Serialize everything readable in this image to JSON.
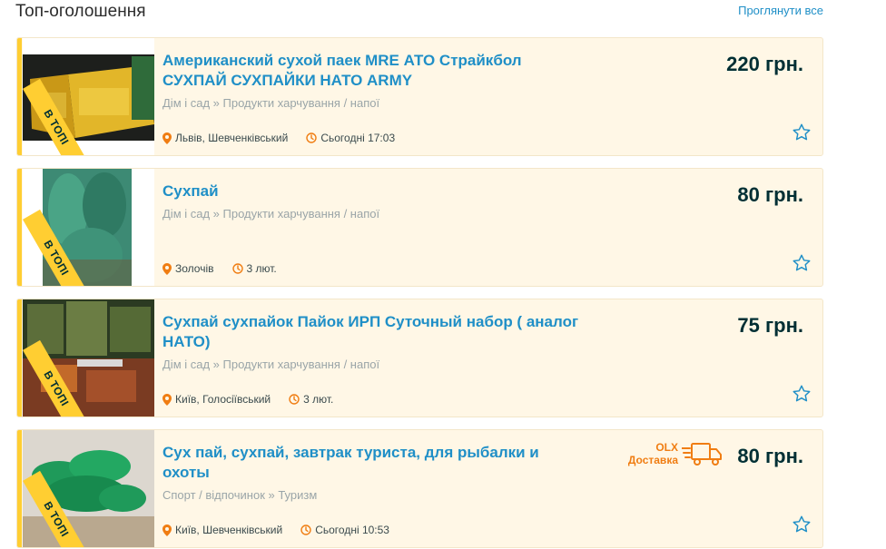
{
  "header": {
    "title": "Топ-оголошення",
    "view_all": "Проглянути все"
  },
  "listings": [
    {
      "title": "Американский сухой паек MRE АТО Страйкбол СУХПАЙ СУХПАЙКИ НАТО ARMY",
      "category": "Дім і сад » Продукти харчування / напої",
      "location": "Львів, Шевченківський",
      "date": "Сьогодні 17:03",
      "price": "220 грн.",
      "badge": "В ТОПІ"
    },
    {
      "title": "Сухпай",
      "category": "Дім і сад » Продукти харчування / напої",
      "location": "Золочів",
      "date": "3 лют.",
      "price": "80 грн.",
      "badge": "В ТОПІ"
    },
    {
      "title": "Сухпай сухпайок Пайок ИРП Суточный набор ( аналог НАТО)",
      "category": "Дім і сад » Продукти харчування / напої",
      "location": "Київ, Голосіївський",
      "date": "3 лют.",
      "price": "75 грн.",
      "badge": "В ТОПІ"
    },
    {
      "title": "Сух пай, сухпай, завтрак туриста, для рыбалки и охоты",
      "category": "Спорт / відпочинок » Туризм",
      "location": "Київ, Шевченківський",
      "date": "Сьогодні 10:53",
      "price": "80 грн.",
      "badge": "В ТОПІ",
      "delivery_line1": "OLX",
      "delivery_line2": "Доставка"
    }
  ],
  "colors": {
    "accent_blue": "#1f8fc7",
    "badge_yellow": "#ffce32",
    "card_bg": "#fff7e6",
    "delivery_orange": "#f07d12"
  },
  "icons": [
    "location-pin-icon",
    "clock-icon",
    "star-outline-icon",
    "delivery-truck-icon"
  ]
}
